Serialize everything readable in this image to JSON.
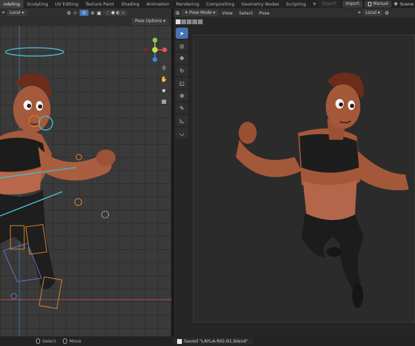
{
  "workspace_tabs": [
    "odeling",
    "Sculpting",
    "UV Editing",
    "Texture Paint",
    "Shading",
    "Animation",
    "Rendering",
    "Compositing",
    "Geometry Nodes",
    "Scripting"
  ],
  "active_tab_index": 0,
  "add_tab_glyph": "+",
  "top_right": {
    "export": "Export",
    "import": "Import",
    "manual": "Manual",
    "scene": "Scene"
  },
  "left_editor": {
    "transform_orientation": "Local",
    "pose_options": "Pose Options"
  },
  "right_editor": {
    "mode": "Pose Mode",
    "menus": [
      "View",
      "Select",
      "Pose"
    ],
    "transform_orientation": "Local"
  },
  "status_bar": {
    "select": "Select",
    "move": "Move",
    "saved_message": "Saved \"LAYLA-RIG-91.blend\""
  },
  "colors": {
    "accent": "#4772b3",
    "axis_x": "#e0525c",
    "axis_y": "#8bd13a",
    "axis_z": "#3f86d6"
  }
}
